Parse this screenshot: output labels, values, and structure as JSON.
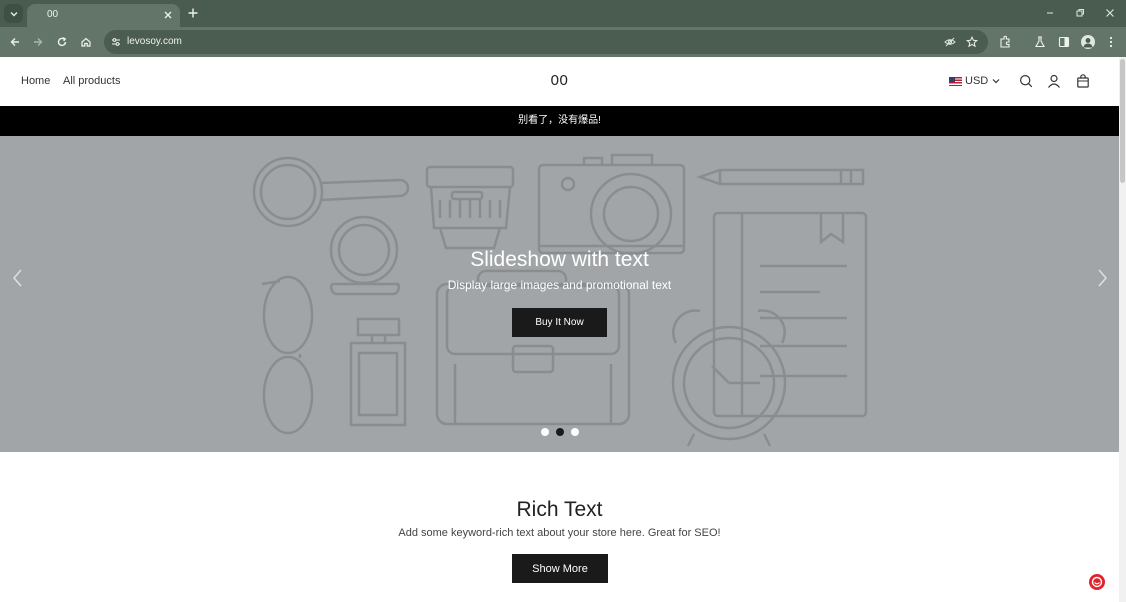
{
  "browser": {
    "tab_title": "00",
    "url": "levosoy.com"
  },
  "header": {
    "nav": [
      "Home",
      "All products"
    ],
    "logo": "00",
    "currency": "USD"
  },
  "announcement": "别看了，没有爆品!",
  "slideshow": {
    "title": "Slideshow with text",
    "subtitle": "Display large images and promotional text",
    "button": "Buy It Now",
    "slide_count": 3,
    "active_slide": 2
  },
  "rich_text": {
    "title": "Rich Text",
    "text": "Add some keyword-rich text about your store here. Great for SEO!",
    "button": "Show More"
  },
  "colors": {
    "chrome_dark": "#4a5c4f",
    "chrome_light": "#637568",
    "hero_bg": "#a2a5a7",
    "button_bg": "#1a1a1a",
    "chat_red": "#e0242a"
  }
}
